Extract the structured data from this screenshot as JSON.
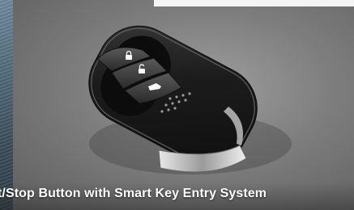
{
  "caption": "t/Stop Button with Smart Key Entry System",
  "image": {
    "subject": "smart-key-fob",
    "buttons": [
      "lock-icon",
      "unlock-icon",
      "trunk-icon"
    ]
  },
  "colors": {
    "background": "#7d7d7d",
    "fob_body": "#1b1b1b",
    "fob_chrome": "#c8c8c8",
    "caption_text": "#ffffff"
  }
}
